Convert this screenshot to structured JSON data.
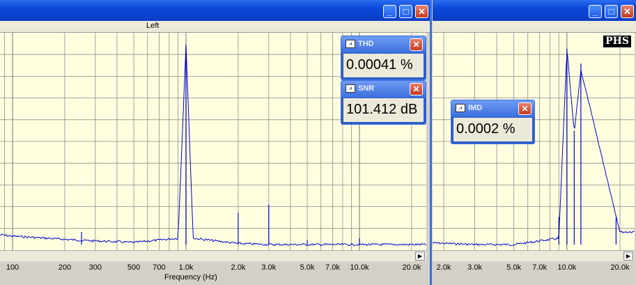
{
  "colors": {
    "plot_bg": "#ffffe0",
    "trace": "#0000cc",
    "grid": "#808080",
    "titlebar": "#0b49d8",
    "frame": "#3b6fe0"
  },
  "left_window": {
    "channel_label": "Left",
    "xlabel": "Frequency (Hz)",
    "x_ticks": [
      "100",
      "200",
      "300",
      "500",
      "700",
      "1.0k",
      "2.0k",
      "3.0k",
      "5.0k",
      "7.0k",
      "10.0k",
      "20.0k"
    ],
    "title_buttons": [
      "minimize",
      "maximize",
      "close"
    ]
  },
  "right_window": {
    "x_ticks": [
      "2.0k",
      "3.0k",
      "5.0k",
      "7.0k",
      "10.0k",
      "20.0k"
    ],
    "logo": "PHS",
    "title_buttons": [
      "minimize",
      "maximize",
      "close"
    ]
  },
  "meters": {
    "thd": {
      "title": "THD",
      "value": "0.00041 %"
    },
    "snr": {
      "title": "SNR",
      "value": "101.412 dB"
    },
    "imd": {
      "title": "IMD",
      "value": "0.0002 %"
    }
  },
  "chart_data": [
    {
      "type": "line",
      "title": "Left",
      "xlabel": "Frequency (Hz)",
      "x_scale": "log",
      "grid": true,
      "series": [
        {
          "x": [
            60,
            100,
            250,
            500,
            900,
            1000,
            1100,
            2000,
            3000,
            5000,
            10000,
            20000
          ],
          "y": [
            0.08,
            0.06,
            0.04,
            0.03,
            0.05,
            0.97,
            0.05,
            0.025,
            0.02,
            0.02,
            0.02,
            0.02
          ]
        }
      ],
      "spikes": [
        {
          "x": 250,
          "y": 0.08
        },
        {
          "x": 1000,
          "y": 0.97
        },
        {
          "x": 2000,
          "y": 0.17
        },
        {
          "x": 3000,
          "y": 0.21
        },
        {
          "x": 5000,
          "y": 0.04
        },
        {
          "x": 10000,
          "y": 0.05
        }
      ]
    },
    {
      "type": "line",
      "x_scale": "log",
      "grid": true,
      "series": [
        {
          "x": [
            1500,
            3000,
            5000,
            9000,
            10000,
            11000,
            12000,
            20000
          ],
          "y": [
            0.03,
            0.02,
            0.02,
            0.05,
            0.95,
            0.55,
            0.85,
            0.08
          ]
        }
      ],
      "spikes": [
        {
          "x": 9000,
          "y": 0.15
        },
        {
          "x": 10000,
          "y": 0.95
        },
        {
          "x": 11000,
          "y": 0.56
        },
        {
          "x": 12000,
          "y": 0.88
        },
        {
          "x": 19000,
          "y": 0.15
        }
      ]
    }
  ]
}
